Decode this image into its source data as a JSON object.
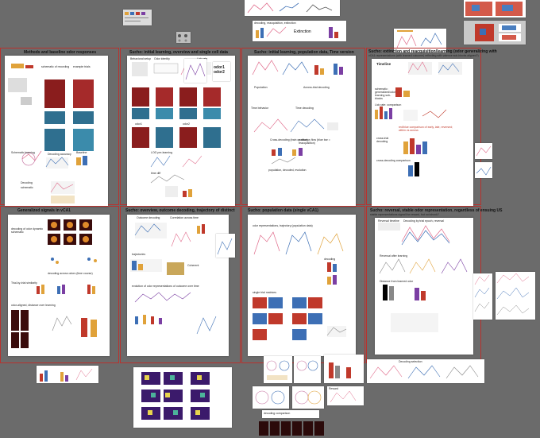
{
  "sections": [
    {
      "id": "methods",
      "title": "Methods and baseline odor responses"
    },
    {
      "id": "initial-learning",
      "title": "Sucho: initial learning, overview and single cell data"
    },
    {
      "id": "population-time",
      "title": "Sucho: initial learning, population data, Time version"
    },
    {
      "id": "extinction",
      "title": "Sucho: extinction and reacquisition/learning (odor generalizing with"
    },
    {
      "id": "generalized",
      "title": "Generalized signals in vCA1"
    },
    {
      "id": "outcome-decoding",
      "title": "Sucho: overview, outcome decoding, trajectory of distinct"
    },
    {
      "id": "single-vca1",
      "title": "Sucho: population data (single vCA1)"
    },
    {
      "id": "reversal",
      "title": "Sucho: reversal, stable odor representation, regardless of ensuing US"
    }
  ],
  "extinction_subtitle": "vCA1 representations (with learned outcome) reflecting with valence sub-blocks aligned?)",
  "reversal_subtitle": "stable representations signal the reward, but not shock?",
  "labels": {
    "methods_a": "schematic of recording",
    "methods_b": "example trials",
    "methods_c": "Schematic learning",
    "methods_d": "Decoding accuracy",
    "methods_e": "Decoding",
    "methods_f": "Baseline",
    "methods_g": "schematic",
    "init_a": "Behavioral setup",
    "init_b": "Odor identity",
    "init_c": "Lick rate",
    "init_d": "odor1",
    "init_e": "odor2",
    "init_f": "LOG pre-learning",
    "init_g": "time diff",
    "pop_a": "Population",
    "pop_b": "Across-trial decoding",
    "pop_c": "Time behavior",
    "pop_d": "Time decoding",
    "pop_e": "Cross-decoding (train on odor)",
    "pop_f": "pathways flow (blue bar = reacquisition)",
    "pop_g": "population, decoded, evolution",
    "ext_a": "Timeline",
    "ext_b": "schematic: generalized/odor learning sub-blocks",
    "ext_c": "Lick rate: comparison",
    "ext_d": "cross-trial decoding",
    "ext_e": "cross-decoding comparison",
    "ext_red": "red/blue comparison of early, late, reversed; within vs across",
    "gen_a": "decoding of odor dynamic schematic",
    "gen_b": "decoding across odors (time course)",
    "gen_c": "Trial-by-trial similarity",
    "gen_d": "odor-aligned, distance over learning",
    "out_a": "Outcome decoding",
    "out_b": "Correlation across time",
    "out_c": "trajectories",
    "out_d": "Coherent",
    "out_e": "evolution of odor representations of outcome over time",
    "sv_a": "odor representations, trajectory (population data)",
    "sv_b": "decoding",
    "sv_c": "single trial matrices",
    "rev_a": "Reversal timeline",
    "rev_b": "Decoding by trial epoch, reversal",
    "rev_c": "Reversal after learning",
    "rev_d": "Distance from learned odor",
    "misc_a": "decoding, reacquisition, extinction",
    "misc_b": "Extinction",
    "misc_c": "Decoding selection",
    "misc_d": "Reward",
    "misc_e": "decoding comparison",
    "init_big": "odor1 odor2"
  },
  "colors": {
    "background": "#6b6b6b",
    "frame": "#b8322e",
    "page": "#ffffff",
    "heat_hot": "#8a1d1d",
    "heat_cool": "#2f6f8f",
    "bar_orange": "#e0a23a",
    "bar_blue": "#3d6fb5",
    "bar_red": "#c0392b",
    "bar_purple": "#7b3fa3",
    "line_pink": "#e06a8a"
  },
  "icons": [
    "heatmap-icon",
    "bar-chart-icon",
    "line-chart-icon",
    "scatter-icon",
    "schematic-icon"
  ]
}
